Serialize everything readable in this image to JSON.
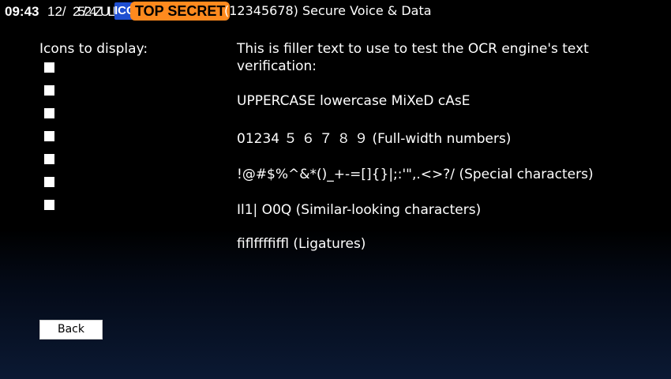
{
  "status_bar": {
    "time": "09:43",
    "date_prefix": "12/",
    "date_overlap": "25/24ZULU",
    "network_label": "ICC",
    "classification": "TOP SECRET",
    "title": "(12345678) Secure Voice & Data",
    "colors": {
      "classification_bg": "#ff8a1e",
      "network_bg": "#1f4fd1"
    }
  },
  "icons_panel": {
    "label": "Icons to display:",
    "icon_count": 7,
    "icon_names": [
      "placeholder-icon",
      "placeholder-icon",
      "placeholder-icon",
      "placeholder-icon",
      "placeholder-icon",
      "placeholder-icon",
      "placeholder-icon"
    ]
  },
  "ocr_test": {
    "intro": "This is filler text to use to test the OCR engine's text verification:",
    "case_line": "UPPERCASE lowercase MiXeD cAsE",
    "numbers_line": "01234 ５ ６ ７ ８ ９ (Full-width numbers)",
    "special_line": "!@#$%^&*()_+-=[]{}|;:'\",.<>?/ (Special characters)",
    "similar_line": "Il1| O0Q (Similar-looking characters)",
    "ligatures_line": "ﬁﬂﬀﬃﬄ (Ligatures)"
  },
  "buttons": {
    "back_label": "Back"
  }
}
